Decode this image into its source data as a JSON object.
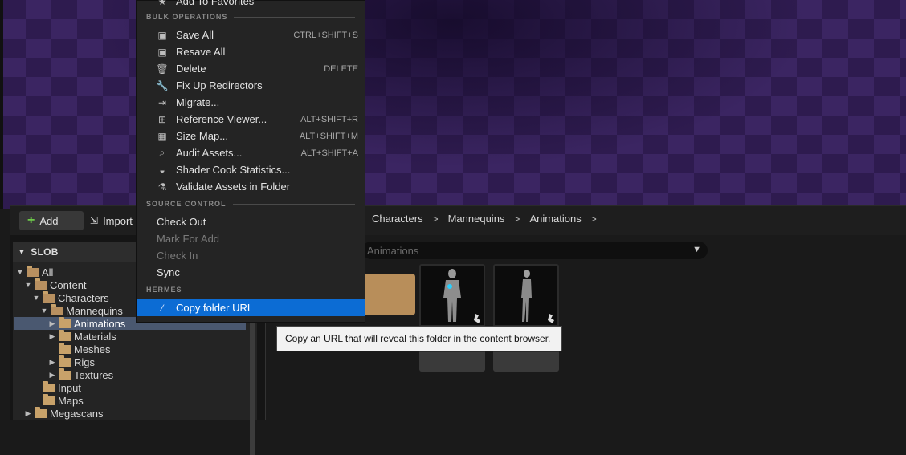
{
  "menu": {
    "top_item": "Add To Favorites",
    "sections": {
      "bulk": "BULK OPERATIONS",
      "source": "SOURCE CONTROL",
      "hermes": "HERMES"
    },
    "bulk_items": [
      {
        "label": "Save All",
        "shortcut": "CTRL+SHIFT+S",
        "icon": "save-icon"
      },
      {
        "label": "Resave All",
        "shortcut": "",
        "icon": "save-icon"
      },
      {
        "label": "Delete",
        "shortcut": "DELETE",
        "icon": "trash-icon"
      },
      {
        "label": "Fix Up Redirectors",
        "shortcut": "",
        "icon": "wrench-icon"
      },
      {
        "label": "Migrate...",
        "shortcut": "",
        "icon": "migrate-icon"
      },
      {
        "label": "Reference Viewer...",
        "shortcut": "ALT+SHIFT+R",
        "icon": "reference-viewer-icon"
      },
      {
        "label": "Size Map...",
        "shortcut": "ALT+SHIFT+M",
        "icon": "size-map-icon"
      },
      {
        "label": "Audit Assets...",
        "shortcut": "ALT+SHIFT+A",
        "icon": "audit-icon"
      },
      {
        "label": "Shader Cook Statistics...",
        "shortcut": "",
        "icon": "shader-stats-icon"
      },
      {
        "label": "Validate Assets in Folder",
        "shortcut": "",
        "icon": "flask-icon"
      }
    ],
    "source_items": [
      {
        "label": "Check Out",
        "disabled": false
      },
      {
        "label": "Mark For Add",
        "disabled": true
      },
      {
        "label": "Check In",
        "disabled": true
      },
      {
        "label": "Sync",
        "disabled": false
      }
    ],
    "hermes_items": [
      {
        "label": "Copy folder URL",
        "icon": "link-icon",
        "highlighted": true
      }
    ]
  },
  "tooltip": "Copy an URL that will reveal this folder in the content browser.",
  "toolbar": {
    "add_label": "Add",
    "import_label": "Import"
  },
  "breadcrumb": [
    "Characters",
    "Mannequins",
    "Animations"
  ],
  "filter": {
    "text": "Animations"
  },
  "tree": {
    "header": "SLOB",
    "items": [
      {
        "label": "All",
        "depth": 0,
        "expanded": true
      },
      {
        "label": "Content",
        "depth": 1,
        "expanded": true
      },
      {
        "label": "Characters",
        "depth": 2,
        "expanded": true
      },
      {
        "label": "Mannequins",
        "depth": 3,
        "expanded": true
      },
      {
        "label": "Animations",
        "depth": 4,
        "expanded": false,
        "selected": true
      },
      {
        "label": "Materials",
        "depth": 4,
        "expanded": false
      },
      {
        "label": "Meshes",
        "depth": 4,
        "expanded": false
      },
      {
        "label": "Rigs",
        "depth": 4,
        "expanded": false
      },
      {
        "label": "Textures",
        "depth": 4,
        "expanded": false
      },
      {
        "label": "Input",
        "depth": 2,
        "expanded": false
      },
      {
        "label": "Maps",
        "depth": 2,
        "expanded": false
      },
      {
        "label": "Megascans",
        "depth": 2,
        "expanded": false
      }
    ]
  },
  "colors": {
    "menu_highlight": "#0c6cd4",
    "tree_selection": "#4a5870",
    "folder": "#c8a26a",
    "viewport": "#3a2460"
  }
}
